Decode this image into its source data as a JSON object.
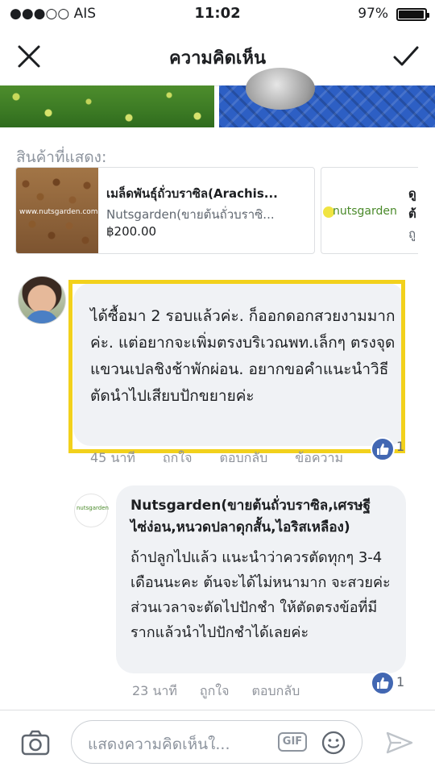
{
  "status_bar": {
    "carrier": "●●●○○ AIS",
    "time": "11:02",
    "battery": "97%",
    "battery_level": 0.97
  },
  "nav": {
    "title": "ความคิดเห็น",
    "close_icon": "close-icon",
    "confirm_icon": "check-icon"
  },
  "products": {
    "label": "สินค้าที่แสดง:",
    "items": [
      {
        "name": "เมล็ดพันธุ์ถั่วบราซิล(Arachis...",
        "seller": "Nutsgarden(ขายต้นถั่วบราซิ...",
        "price": "฿200.00",
        "image_watermark": "www.nutsgarden.com"
      },
      {
        "logo_text": "nutsgarden",
        "name": "ดู",
        "sub": "ต้",
        "seller": "ถู"
      }
    ]
  },
  "comment": {
    "text": "ได้ซื้อมา  2 รอบแล้วค่ะ. ก็ออกดอกสวยงามมากค่ะ.  แต่อยากจะเพิ่มตรงบริเวณพท.เล็กๆ ตรงจุดแขวนเปลชิงช้าพักผ่อน.  อยากขอคำแนะนำวิธีตัดนำไปเสียบปักขยายค่ะ",
    "time": "45 นาที",
    "like_label": "ถูกใจ",
    "reply_label": "ตอบกลับ",
    "more_label": "ข้อความ",
    "like_count": "1"
  },
  "reply": {
    "avatar_text": "nutsgarden",
    "author": "Nutsgarden(ขายต้นถั่วบราซิล,เศรษฐีไซ่ง่อน,หนวดปลาดุกสั้น,ไอริสเหลือง)",
    "text": "ถ้าปลูกไปแล้ว แนะนำว่าควรตัดทุกๆ 3-4 เดือนนะคะ ต้นจะได้ไม่หนามาก จะสวยค่ะ ส่วนเวลาจะตัดไปปักชำ ให้ตัดตรงข้อที่มีรากแล้วนำไปปักชำได้เลยค่ะ",
    "time": "23 นาที",
    "like_label": "ถูกใจ",
    "reply_label": "ตอบกลับ",
    "like_count": "1"
  },
  "composer": {
    "placeholder": "แสดงความคิดเห็นใ...",
    "gif_label": "GIF",
    "camera_icon": "camera-icon",
    "emoji_icon": "emoji-icon",
    "send_icon": "send-icon"
  },
  "colors": {
    "accent": "#4267b2",
    "highlight": "#f2d11c",
    "bubble": "#f0f2f5"
  }
}
